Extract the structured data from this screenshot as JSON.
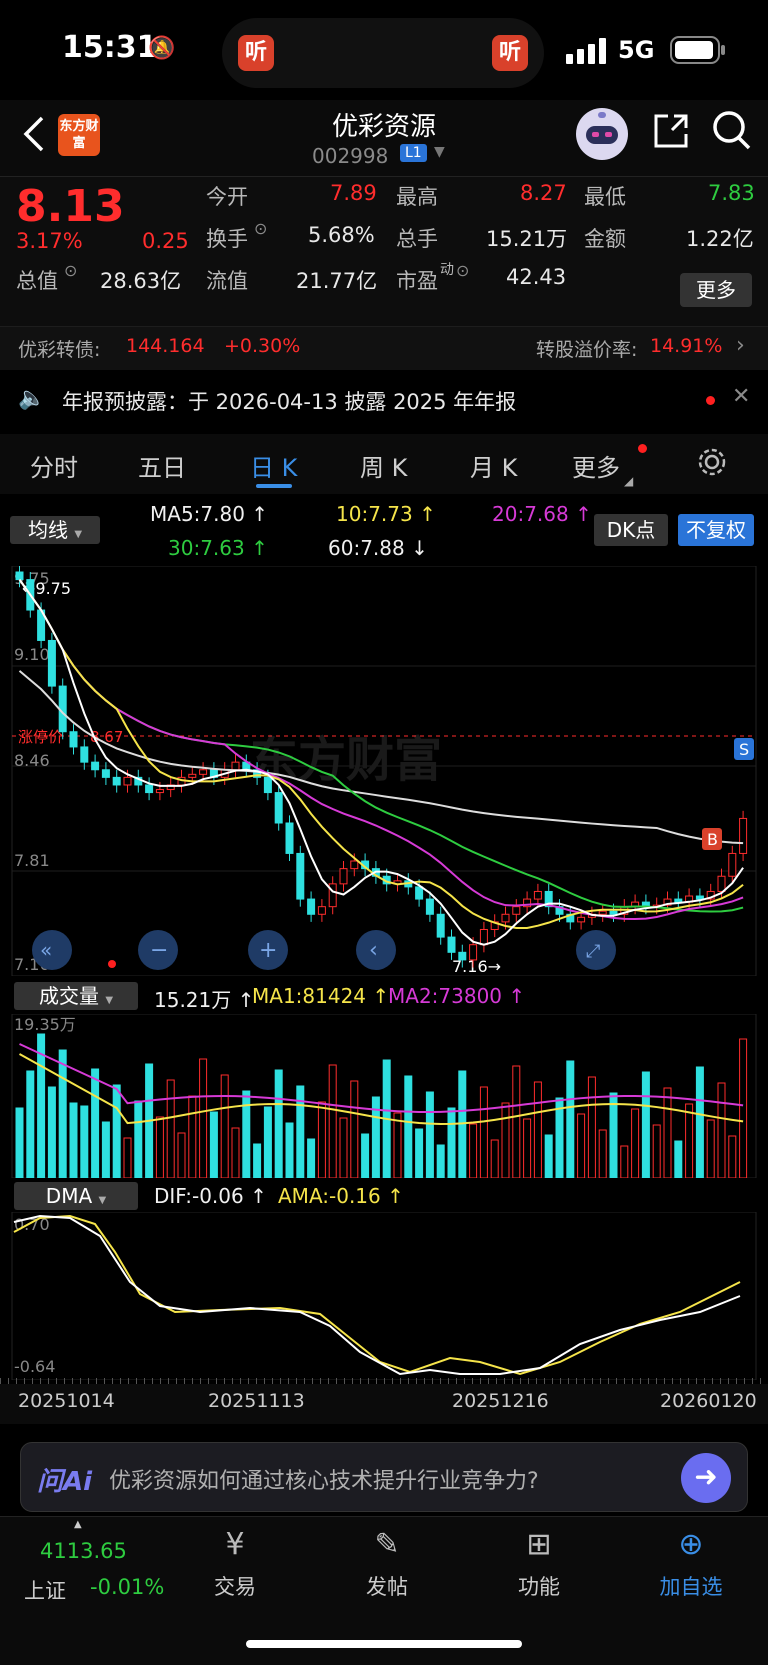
{
  "status_bar": {
    "time": "15:31",
    "network": "5G",
    "island_app_label": "听"
  },
  "header": {
    "stock_name": "优彩资源",
    "stock_code": "002998",
    "level_badge": "L1",
    "logo_text": "东方财富"
  },
  "quote": {
    "price": "8.13",
    "change_pct": "3.17%",
    "change": "0.25",
    "open_label": "今开",
    "open": "7.89",
    "high_label": "最高",
    "high": "8.27",
    "low_label": "最低",
    "low": "7.83",
    "turnover_label": "换手",
    "turnover": "5.68%",
    "volume_label": "总手",
    "volume": "15.21万",
    "amount_label": "金额",
    "amount": "1.22亿",
    "mktcap_label": "总值",
    "mktcap": "28.63亿",
    "float_label": "流值",
    "float": "21.77亿",
    "pe_label": "市盈",
    "pe_sup": "动",
    "pe": "42.43",
    "more_label": "更多"
  },
  "bond": {
    "label": "优彩转债:",
    "price": "144.164",
    "change": "+0.30%",
    "premium_label": "转股溢价率:",
    "premium": "14.91%"
  },
  "notice": {
    "text": "年报预披露：于 2026-04-13 披露 2025 年年报"
  },
  "tabs": [
    "分时",
    "五日",
    "日 K",
    "周 K",
    "月 K",
    "更多"
  ],
  "ma_row": {
    "selector": "均线",
    "ma5": "MA5:7.80 ↑",
    "ma10": "10:7.73 ↑",
    "ma20": "20:7.68 ↑",
    "ma30": "30:7.63 ↑",
    "ma60": "60:7.88 ↓",
    "dk_label": "DK点",
    "fq_label": "不复权"
  },
  "kline": {
    "y_labels": [
      "9.75",
      "9.10",
      "8.46",
      "7.81",
      "7.16"
    ],
    "high_marker": "←9.75",
    "low_marker": "7.16→",
    "limit_label": "涨停价",
    "limit_value": "8.67",
    "marker_s": "S",
    "marker_b": "B",
    "watermark": "东方财富"
  },
  "volume": {
    "selector": "成交量",
    "total": "15.21万 ↑",
    "ma1": "MA1:81424 ↑",
    "ma2": "MA2:73800 ↑",
    "max_label": "19.35万"
  },
  "dma": {
    "selector": "DMA",
    "dif": "DIF:-0.06 ↑",
    "ama": "AMA:-0.16 ↑",
    "top_label": "0.70",
    "bottom_label": "-0.64"
  },
  "dates": [
    "20251014",
    "20251113",
    "20251216",
    "20260120"
  ],
  "ai": {
    "logo": "问Ai",
    "prompt": "优彩资源如何通过核心技术提升行业竞争力?"
  },
  "nav": {
    "index_value": "4113.65",
    "index_name": "上证",
    "index_change": "-0.01%",
    "trade": "交易",
    "post": "发帖",
    "func": "功能",
    "add": "加自选"
  },
  "colors": {
    "up": "#ff2d2d",
    "down": "#2fe0e0",
    "accent": "#3a8ee6"
  },
  "chart_data": {
    "type": "candlestick",
    "y_range": [
      7.16,
      9.75
    ],
    "dates": [
      "20251014",
      "20251113",
      "20251216",
      "20260120"
    ],
    "price_high": 9.75,
    "price_low": 7.16,
    "limit_up": 8.67,
    "last": {
      "open": 7.89,
      "high": 8.27,
      "low": 7.83,
      "close": 8.13
    }
  }
}
